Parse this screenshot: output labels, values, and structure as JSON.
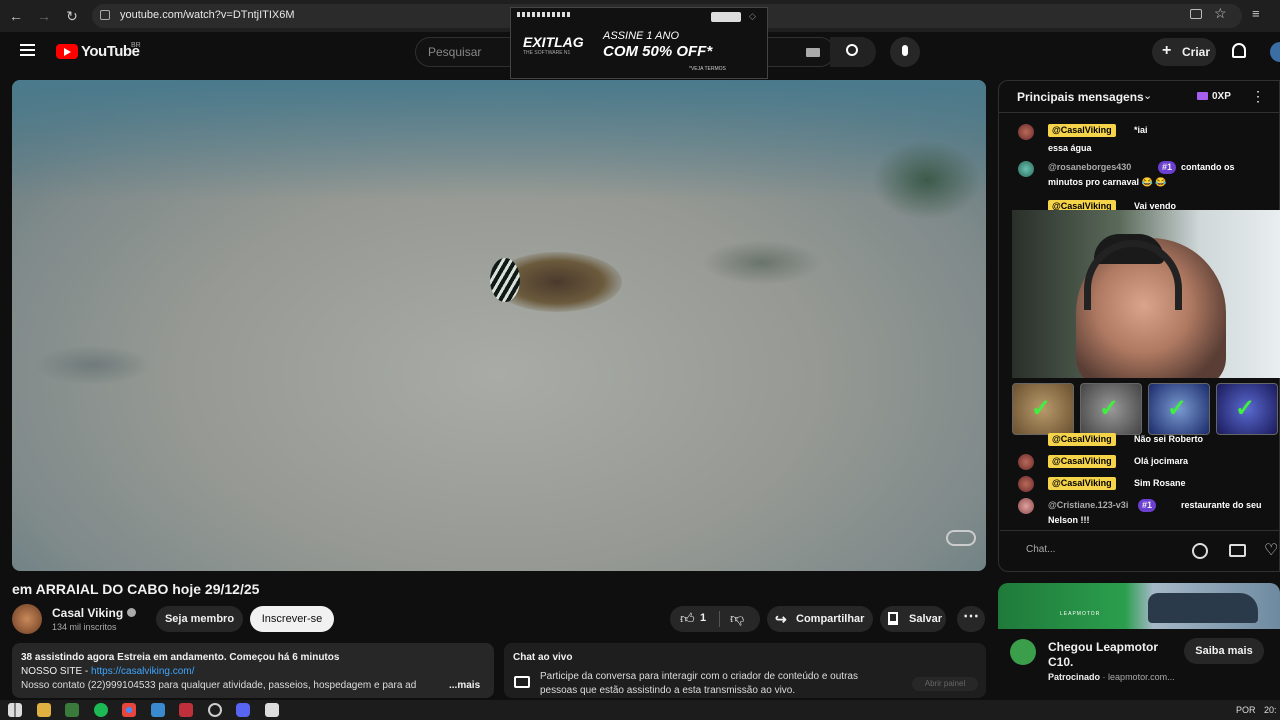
{
  "browser": {
    "url": "youtube.com/watch?v=DTntjITIX6M",
    "back_icon": "←",
    "forward_icon": "→",
    "reload_icon": "↻"
  },
  "header": {
    "logo_text": "YouTube",
    "region": "BR",
    "search_placeholder": "Pesquisar",
    "create_label": "Criar"
  },
  "ad": {
    "brand": "EXITLAG",
    "tagline": "THE SOFTWARE N1",
    "line1": "ASSINE 1 ANO",
    "line2": "COM 50% OFF*",
    "footnote": "*VEJA TERMOS"
  },
  "video": {
    "title": "em ARRAIAL DO CABO hoje 29/12/25"
  },
  "channel": {
    "name": "Casal Viking",
    "subscribers": "134 mil inscritos",
    "member_label": "Seja membro",
    "subscribe_label": "Inscrever-se"
  },
  "actions": {
    "likes": "1",
    "share_label": "Compartilhar",
    "save_label": "Salvar"
  },
  "description": {
    "line1": "38 assistindo agora  Estreia em andamento. Começou há 6 minutos",
    "line2_prefix": "NOSSO SITE - ",
    "line2_link": "https://casalviking.com/",
    "line3": "Nosso contato (22)999104533 para qualquer atividade, passeios, hospedagem e para ad",
    "more": "...mais"
  },
  "live_chat_promo": {
    "title": "Chat ao vivo",
    "text_line1": "Participe da conversa para interagir com o criador de conteúdo e outras",
    "text_line2": "pessoas que estão assistindo a esta transmissão ao vivo.",
    "open_label": "Abrir painel"
  },
  "chat": {
    "header": "Principais mensagens",
    "points": "0XP",
    "input_placeholder": "Chat...",
    "messages": [
      {
        "author": "@CasalViking",
        "text": "*iai"
      },
      {
        "author": "",
        "text": "essa água"
      },
      {
        "author": "@rosaneborges430",
        "rank": "#1",
        "text": "contando os"
      },
      {
        "author": "",
        "text": "minutos pro carnaval 😂 😂"
      },
      {
        "author": "@CasalViking",
        "text": "Vai vendo"
      },
      {
        "author": "@CasalViking",
        "text": "Não sei Roberto"
      },
      {
        "author": "@CasalViking",
        "text": "Olá jocimara"
      },
      {
        "author": "@CasalViking",
        "text": "Sim Rosane"
      },
      {
        "author": "@Cristiane.123-v3i",
        "rank": "#1",
        "text": "restaurante do seu"
      },
      {
        "author": "",
        "text": "Nelson !!!"
      }
    ]
  },
  "sponsored": {
    "brand_logo": "LEAPMOTOR",
    "title_line1": "Chegou Leapmotor",
    "title_line2": "C10.",
    "label": "Patrocinado",
    "domain": "leapmotor.com...",
    "cta": "Saiba mais"
  },
  "taskbar": {
    "lang": "POR",
    "time": "20:"
  }
}
